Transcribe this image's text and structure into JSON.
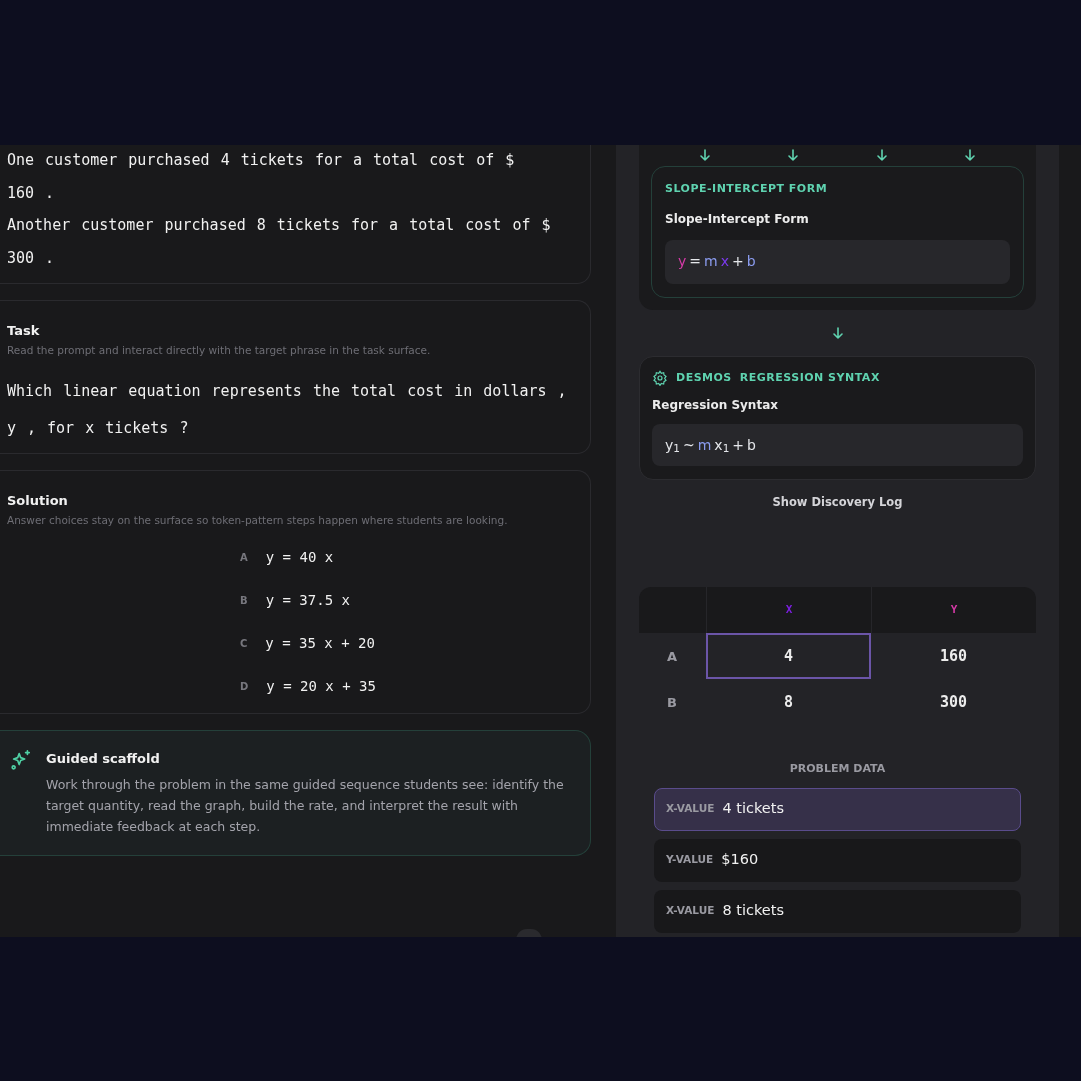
{
  "prompt_lines": [
    [
      "One",
      "customer",
      "purchased",
      "4",
      "tickets",
      "for",
      "a",
      "total",
      "cost",
      "of",
      "$"
    ],
    [
      "160",
      "."
    ],
    [
      "Another",
      "customer",
      "purchased",
      "8",
      "tickets",
      "for",
      "a",
      "total",
      "cost",
      "of",
      "$"
    ],
    [
      "300",
      "."
    ]
  ],
  "task": {
    "title": "Task",
    "subtitle": "Read the prompt and interact directly with the target phrase in the task surface.",
    "question_lines": [
      [
        "Which",
        "linear",
        "equation",
        "represents",
        "the",
        "total",
        "cost",
        "in",
        "dollars",
        ","
      ],
      [
        "y",
        ",",
        "for",
        "x",
        "tickets",
        "?"
      ]
    ]
  },
  "solution": {
    "title": "Solution",
    "subtitle": "Answer choices stay on the surface so token-pattern steps happen where students are looking.",
    "choices": [
      {
        "letter": "A",
        "equation": "y = 40 x"
      },
      {
        "letter": "B",
        "equation": "y = 37.5 x"
      },
      {
        "letter": "C",
        "equation": "y = 35 x + 20"
      },
      {
        "letter": "D",
        "equation": "y = 20 x + 35"
      }
    ]
  },
  "scaffold": {
    "title": "Guided scaffold",
    "body": "Work through the problem in the same guided sequence students see: identify the target quantity, read the graph, build the rate, and interpret the result with immediate feedback at each step."
  },
  "slope_card": {
    "label": "SLOPE-INTERCEPT FORM",
    "title": "Slope-Intercept Form",
    "tokens": [
      {
        "text": "y",
        "color": "#d63aa8"
      },
      {
        "text": "=",
        "color": "#e5e7eb"
      },
      {
        "text": "m",
        "color": "#8b9cf0"
      },
      {
        "text": "x",
        "color": "#7c3aed"
      },
      {
        "text": "+",
        "color": "#e5e7eb"
      },
      {
        "text": "b",
        "color": "#8b9cf0"
      }
    ]
  },
  "desmos_card": {
    "label": "DESMOS",
    "label_2": "REGRESSION SYNTAX",
    "title": "Regression Syntax",
    "tokens": [
      {
        "text": "y$_{1}$",
        "color": "#e5e7eb"
      },
      {
        "text": "~",
        "color": "#e5e7eb"
      },
      {
        "text": "m",
        "color": "#8b9cf0"
      },
      {
        "text": "x$_{1}$",
        "color": "#e5e7eb"
      },
      {
        "text": "+",
        "color": "#e5e7eb"
      },
      {
        "text": "b",
        "color": "#e5e7eb"
      }
    ]
  },
  "discovery_log": "Show Discovery Log",
  "table": {
    "columns": [
      {
        "label": "X",
        "color": "#7c1fe0"
      },
      {
        "label": "Y",
        "color": "#d63aa8"
      }
    ],
    "rows": [
      {
        "label": "A",
        "cells": [
          {
            "text": "4",
            "selected": true
          },
          {
            "text": "160",
            "selected": false
          }
        ]
      },
      {
        "label": "B",
        "cells": [
          {
            "text": "8",
            "selected": false
          },
          {
            "text": "300",
            "selected": false
          }
        ]
      }
    ]
  },
  "problem_data": {
    "title": "PROBLEM DATA",
    "items": [
      {
        "key": "X-VALUE",
        "value": "4 tickets",
        "selected": true
      },
      {
        "key": "Y-VALUE",
        "value": "$160",
        "selected": false
      },
      {
        "key": "X-VALUE",
        "value": "8 tickets",
        "selected": false
      }
    ]
  }
}
